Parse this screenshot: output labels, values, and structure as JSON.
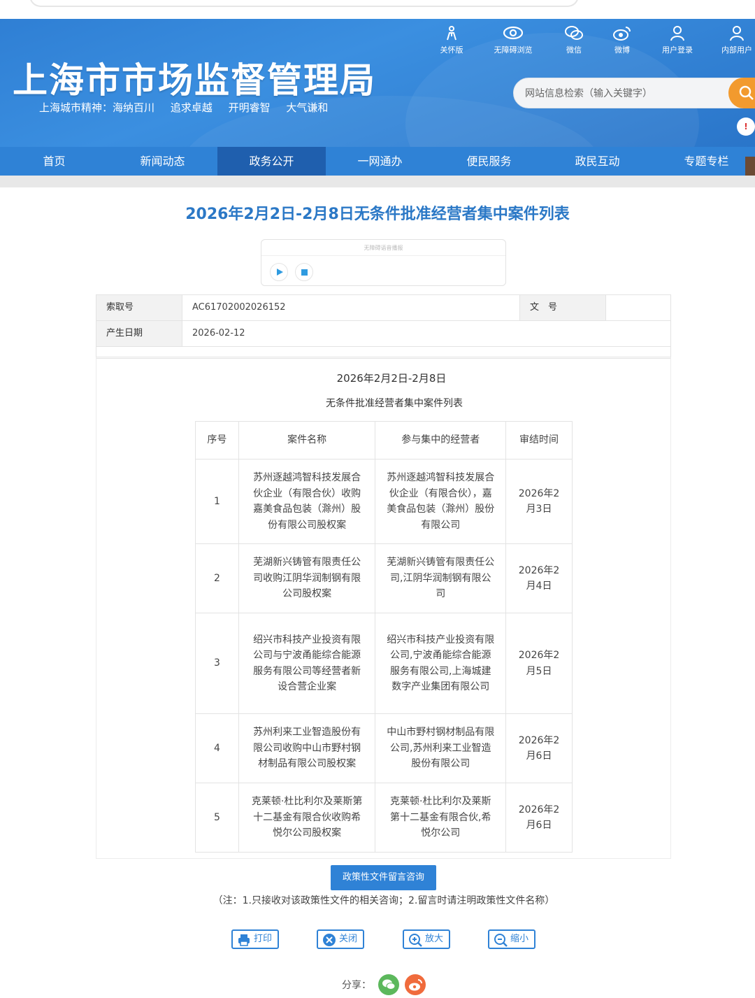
{
  "header": {
    "site_title": "上海市市场监督管理局",
    "spirit": [
      "上海城市精神：海纳百川",
      "追求卓越",
      "开明睿智",
      "大气谦和"
    ],
    "tools": [
      {
        "label": "关怀版",
        "icon": "elder-care-icon"
      },
      {
        "label": "无障碍浏览",
        "icon": "eye-icon"
      },
      {
        "label": "微信",
        "icon": "wechat-icon"
      },
      {
        "label": "微博",
        "icon": "weibo-icon"
      },
      {
        "label": "用户登录",
        "icon": "user-icon"
      },
      {
        "label": "内部用户",
        "icon": "internal-user-icon"
      }
    ],
    "search_placeholder": "网站信息检索（输入关键字）"
  },
  "nav": {
    "items": [
      "首页",
      "新闻动态",
      "政务公开",
      "一网通办",
      "便民服务",
      "政民互动",
      "专题专栏"
    ],
    "active": "政务公开"
  },
  "article": {
    "title": "2026年2月2日-2月8日无条件批准经营者集中案件列表",
    "player_caption": "无障碍语音播报",
    "meta": {
      "index_label": "索取号",
      "index_value": "AC61702002026152",
      "doc_no_label": "文　号",
      "date_label": "产生日期",
      "date_value": "2026-02-12"
    },
    "subtitle1": "2026年2月2日-2月8日",
    "subtitle2": "无条件批准经营者集中案件列表",
    "table": {
      "headers": [
        "序号",
        "案件名称",
        "参与集中的经营者",
        "审结时间"
      ],
      "rows": [
        {
          "no": "1",
          "name": "苏州逐越鸿智科技发展合伙企业（有限合伙）收购嘉美食品包装（滁州）股份有限公司股权案",
          "parties": "苏州逐越鸿智科技发展合伙企业（有限合伙），嘉美食品包装（滁州）股份有限公司",
          "date": "2026年2月3日"
        },
        {
          "no": "2",
          "name": "芜湖新兴铸管有限责任公司收购江阴华润制钢有限公司股权案",
          "parties": "芜湖新兴铸管有限责任公司,江阴华润制钢有限公司",
          "date": "2026年2月4日"
        },
        {
          "no": "3",
          "name": "绍兴市科技产业投资有限公司与宁波甬能综合能源服务有限公司等经营者新设合营企业案",
          "parties": "绍兴市科技产业投资有限公司,宁波甬能综合能源服务有限公司,上海城建数字产业集团有限公司",
          "date": "2026年2月5日"
        },
        {
          "no": "4",
          "name": "苏州利来工业智造股份有限公司收购中山市野村钢材制品有限公司股权案",
          "parties": "中山市野村钢材制品有限公司,苏州利来工业智造股份有限公司",
          "date": "2026年2月6日"
        },
        {
          "no": "5",
          "name": "克莱顿·杜比利尔及莱斯第十二基金有限合伙收购希悦尔公司股权案",
          "parties": "克莱顿·杜比利尔及莱斯第十二基金有限合伙,希悦尔公司",
          "date": "2026年2月6日"
        }
      ]
    },
    "consult_button": "政策性文件留言咨询",
    "note": "（注：1.只接收对该政策性文件的相关咨询；2.留言时请注明政策性文件名称）",
    "actions": [
      {
        "label": "打印",
        "icon": "printer-icon"
      },
      {
        "label": "关闭",
        "icon": "close-icon"
      },
      {
        "label": "放大",
        "icon": "zoom-in-icon"
      },
      {
        "label": "缩小",
        "icon": "zoom-out-icon"
      }
    ],
    "share_label": "分享：",
    "share_icons": [
      "wechat-share-icon",
      "weibo-share-icon"
    ]
  },
  "colors": {
    "brand_blue": "#2f82d6",
    "nav_active": "#1f5fae",
    "title_blue": "#2b78c6",
    "search_orange": "#f29a2e"
  }
}
